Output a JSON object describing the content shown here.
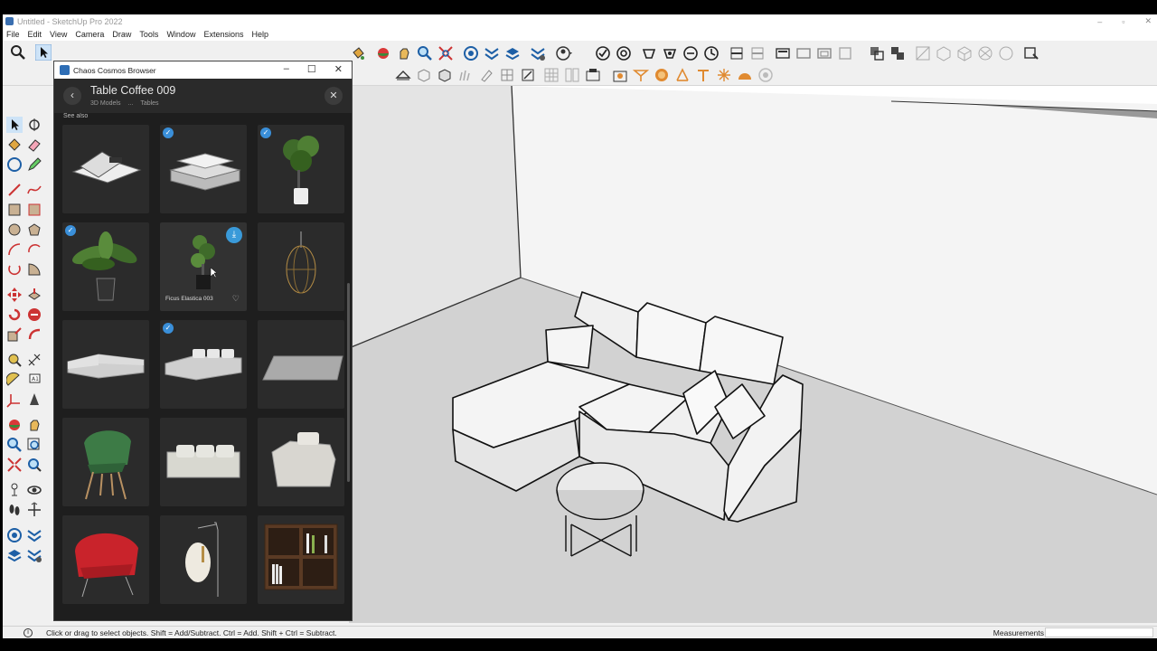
{
  "window": {
    "title": "Untitled - SketchUp Pro 2022",
    "controls": [
      "–",
      "▫",
      "✕"
    ]
  },
  "menu": [
    "File",
    "Edit",
    "View",
    "Camera",
    "Draw",
    "Tools",
    "Window",
    "Extensions",
    "Help"
  ],
  "cosmos": {
    "window_title": "Chaos Cosmos Browser",
    "window_controls": [
      "–",
      "☐",
      "✕"
    ],
    "asset_title": "Table Coffee 009",
    "breadcrumb": [
      "3D Models",
      "...",
      "Tables"
    ],
    "section_label": "See also",
    "tiles": [
      {
        "name": "magazines",
        "checked": false
      },
      {
        "name": "book-stack",
        "checked": true
      },
      {
        "name": "potted-plant-small",
        "checked": true
      },
      {
        "name": "potted-plant-large",
        "checked": true
      },
      {
        "name": "ficus-elastica",
        "checked": false,
        "label": "Ficus Elastica 003",
        "hover": true
      },
      {
        "name": "pendant-lamp",
        "checked": false
      },
      {
        "name": "sectional-sofa-1",
        "checked": false
      },
      {
        "name": "sectional-sofa-2",
        "checked": true
      },
      {
        "name": "rug",
        "checked": false
      },
      {
        "name": "green-chair",
        "checked": false
      },
      {
        "name": "sofa-3seat",
        "checked": false
      },
      {
        "name": "armchair",
        "checked": false
      },
      {
        "name": "red-chair",
        "checked": false
      },
      {
        "name": "floor-lamp",
        "checked": false
      },
      {
        "name": "bookshelf",
        "checked": false
      }
    ]
  },
  "status": {
    "hint": "Click or drag to select objects. Shift = Add/Subtract. Ctrl = Add. Shift + Ctrl = Subtract.",
    "measurements_label": "Measurements"
  }
}
